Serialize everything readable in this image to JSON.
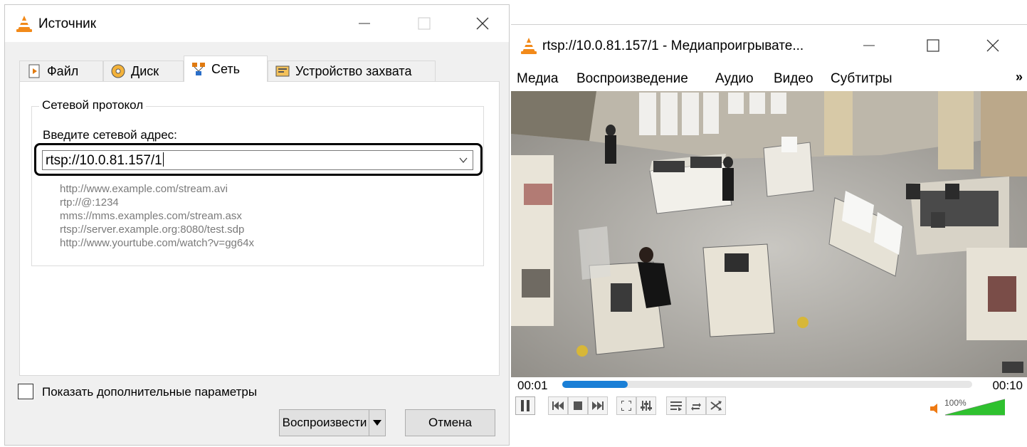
{
  "dialog": {
    "title": "Источник",
    "tabs": [
      {
        "label": "Файл",
        "icon": "file-icon"
      },
      {
        "label": "Диск",
        "icon": "disc-icon"
      },
      {
        "label": "Сеть",
        "icon": "network-icon",
        "active": true
      },
      {
        "label": "Устройство захвата",
        "icon": "capture-device-icon"
      }
    ],
    "group_title": "Сетевой протокол",
    "address_label": "Введите сетевой адрес:",
    "address_value": "rtsp://10.0.81.157/1",
    "examples": [
      "http://www.example.com/stream.avi",
      "rtp://@:1234",
      "mms://mms.examples.com/stream.asx",
      "rtsp://server.example.org:8080/test.sdp",
      "http://www.yourtube.com/watch?v=gg64x"
    ],
    "show_more_label": "Показать дополнительные параметры",
    "show_more_checked": false,
    "play_label": "Воспроизвести",
    "cancel_label": "Отмена"
  },
  "player": {
    "title": "rtsp://10.0.81.157/1 - Медиапроигрывате...",
    "menu": [
      "Медиа",
      "Воспроизведение",
      "Аудио",
      "Видео",
      "Субтитры"
    ],
    "menu_more": "»",
    "time_elapsed": "00:01",
    "time_total": "00:10",
    "progress": 0.16,
    "volume_label": "100%",
    "volume": 1.0,
    "accent_color": "#1a7fd6",
    "volume_color": "#2fc12f"
  }
}
